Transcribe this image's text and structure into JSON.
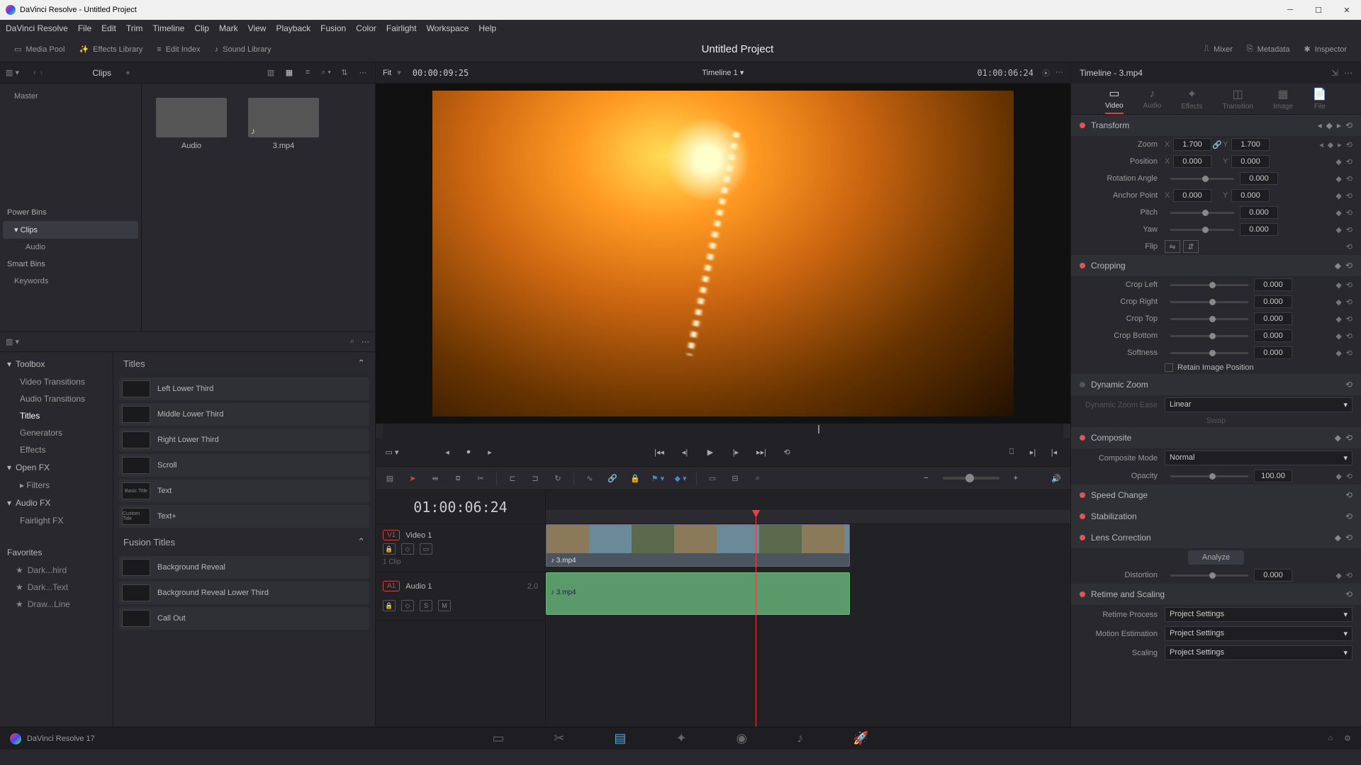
{
  "window": {
    "title": "DaVinci Resolve - Untitled Project"
  },
  "menubar": [
    "DaVinci Resolve",
    "File",
    "Edit",
    "Trim",
    "Timeline",
    "Clip",
    "Mark",
    "View",
    "Playback",
    "Fusion",
    "Color",
    "Fairlight",
    "Workspace",
    "Help"
  ],
  "toolbar": {
    "media_pool": "Media Pool",
    "effects_library": "Effects Library",
    "edit_index": "Edit Index",
    "sound_library": "Sound Library",
    "project_title": "Untitled Project",
    "mixer": "Mixer",
    "metadata": "Metadata",
    "inspector": "Inspector"
  },
  "bins_header": {
    "clips": "Clips"
  },
  "bins_tree": {
    "master": "Master",
    "power_bins": "Power Bins",
    "clips_bin": "Clips",
    "audio_bin": "Audio",
    "smart_bins": "Smart Bins",
    "keywords": "Keywords"
  },
  "media_items": [
    {
      "name": "Audio",
      "type": "folder"
    },
    {
      "name": "3.mp4",
      "type": "video"
    }
  ],
  "fx_tree": {
    "toolbox": "Toolbox",
    "video_transitions": "Video Transitions",
    "audio_transitions": "Audio Transitions",
    "titles": "Titles",
    "generators": "Generators",
    "effects": "Effects",
    "open_fx": "Open FX",
    "filters": "Filters",
    "audio_fx": "Audio FX",
    "fairlight_fx": "Fairlight FX",
    "favorites": "Favorites",
    "fav_items": [
      "Dark...hird",
      "Dark...Text",
      "Draw...Line"
    ]
  },
  "titles_panel": {
    "header": "Titles",
    "items": [
      "Left Lower Third",
      "Middle Lower Third",
      "Right Lower Third",
      "Scroll",
      "Text",
      "Text+"
    ],
    "fusion_header": "Fusion Titles",
    "fusion_items": [
      "Background Reveal",
      "Background Reveal Lower Third",
      "Call Out"
    ]
  },
  "viewer": {
    "fit": "Fit",
    "src_tc": "00:00:09:25",
    "timeline_name": "Timeline 1",
    "rec_tc": "01:00:06:24"
  },
  "timeline": {
    "big_tc": "01:00:06:24",
    "v1": {
      "badge": "V1",
      "name": "Video 1",
      "clip_count": "1 Clip"
    },
    "a1": {
      "badge": "A1",
      "name": "Audio 1",
      "chan": "2.0"
    },
    "clip_name": "3.mp4"
  },
  "inspector_hdr": {
    "clip_name": "Timeline - 3.mp4"
  },
  "inspector_tabs": [
    "Video",
    "Audio",
    "Effects",
    "Transition",
    "Image",
    "File"
  ],
  "transform": {
    "title": "Transform",
    "zoom_label": "Zoom",
    "zoom_x": "1.700",
    "zoom_y": "1.700",
    "position_label": "Position",
    "pos_x": "0.000",
    "pos_y": "0.000",
    "rotation_label": "Rotation Angle",
    "rotation": "0.000",
    "anchor_label": "Anchor Point",
    "anchor_x": "0.000",
    "anchor_y": "0.000",
    "pitch_label": "Pitch",
    "pitch": "0.000",
    "yaw_label": "Yaw",
    "yaw": "0.000",
    "flip_label": "Flip"
  },
  "cropping": {
    "title": "Cropping",
    "left_label": "Crop Left",
    "left": "0.000",
    "right_label": "Crop Right",
    "right": "0.000",
    "top_label": "Crop Top",
    "top": "0.000",
    "bottom_label": "Crop Bottom",
    "bottom": "0.000",
    "softness_label": "Softness",
    "softness": "0.000",
    "retain_label": "Retain Image Position"
  },
  "dynamic_zoom": {
    "title": "Dynamic Zoom",
    "ease_label": "Dynamic Zoom Ease",
    "ease_value": "Linear",
    "swap": "Swap"
  },
  "composite": {
    "title": "Composite",
    "mode_label": "Composite Mode",
    "mode_value": "Normal",
    "opacity_label": "Opacity",
    "opacity": "100.00"
  },
  "speed": {
    "title": "Speed Change"
  },
  "stab": {
    "title": "Stabilization"
  },
  "lens": {
    "title": "Lens Correction",
    "analyze": "Analyze",
    "distortion_label": "Distortion",
    "distortion": "0.000"
  },
  "retime": {
    "title": "Retime and Scaling",
    "process_label": "Retime Process",
    "process": "Project Settings",
    "motion_label": "Motion Estimation",
    "motion": "Project Settings",
    "scaling_label": "Scaling",
    "scaling": "Project Settings"
  },
  "bottombar": {
    "version": "DaVinci Resolve 17"
  }
}
